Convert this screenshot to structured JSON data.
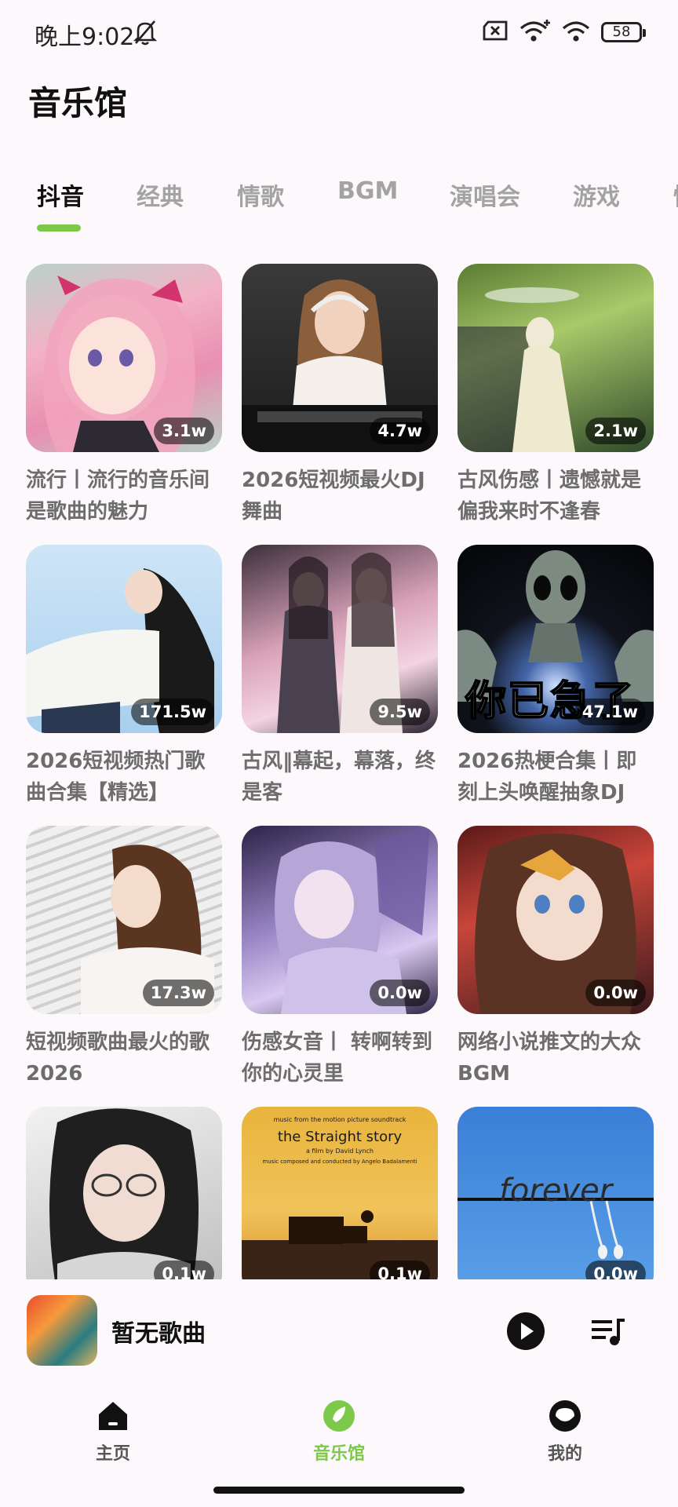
{
  "status_bar": {
    "time": "晚上9:02",
    "battery": "58"
  },
  "page_title": "音乐馆",
  "tabs": [
    {
      "label": "抖音",
      "active": true
    },
    {
      "label": "经典",
      "active": false
    },
    {
      "label": "情歌",
      "active": false
    },
    {
      "label": "BGM",
      "active": false
    },
    {
      "label": "演唱会",
      "active": false
    },
    {
      "label": "游戏",
      "active": false
    },
    {
      "label": "情",
      "active": false
    }
  ],
  "playlists": [
    {
      "title": "流行丨流行的音乐间是歌曲的魅力",
      "play_count": "3.1w"
    },
    {
      "title": "2026短视频最火DJ舞曲",
      "play_count": "4.7w"
    },
    {
      "title": "古风伤感丨遗憾就是偏我来时不逢春",
      "play_count": "2.1w"
    },
    {
      "title": "2026短视频热门歌曲合集【精选】",
      "play_count": "171.5w"
    },
    {
      "title": "古风‖幕起，幕落，终是客",
      "play_count": "9.5w"
    },
    {
      "title": "2026热梗合集丨即刻上头唤醒抽象DJ",
      "play_count": "47.1w",
      "overlay_text": "你已急了"
    },
    {
      "title": "短视频歌曲最火的歌2026",
      "play_count": "17.3w"
    },
    {
      "title": "伤感女音丨 转啊转到你的心灵里",
      "play_count": "0.0w"
    },
    {
      "title": "网络小说推文的大众BGM",
      "play_count": "0.0w"
    },
    {
      "title": "",
      "play_count": "0.1w"
    },
    {
      "title": "",
      "play_count": "0.1w",
      "cover_text": {
        "top": "music from the motion picture soundtrack",
        "main": "the Straight story",
        "sub": "a film by David Lynch",
        "credit": "music composed and conducted by Angelo Badalamenti"
      }
    },
    {
      "title": "",
      "play_count": "0.0w",
      "cover_text": {
        "main": "forever"
      }
    }
  ],
  "mini_player": {
    "title": "暂无歌曲"
  },
  "bottom_nav": [
    {
      "label": "主页",
      "active": false
    },
    {
      "label": "音乐馆",
      "active": true
    },
    {
      "label": "我的",
      "active": false
    }
  ],
  "colors": {
    "accent": "#7cc94a",
    "background": "#fcf8fc"
  }
}
